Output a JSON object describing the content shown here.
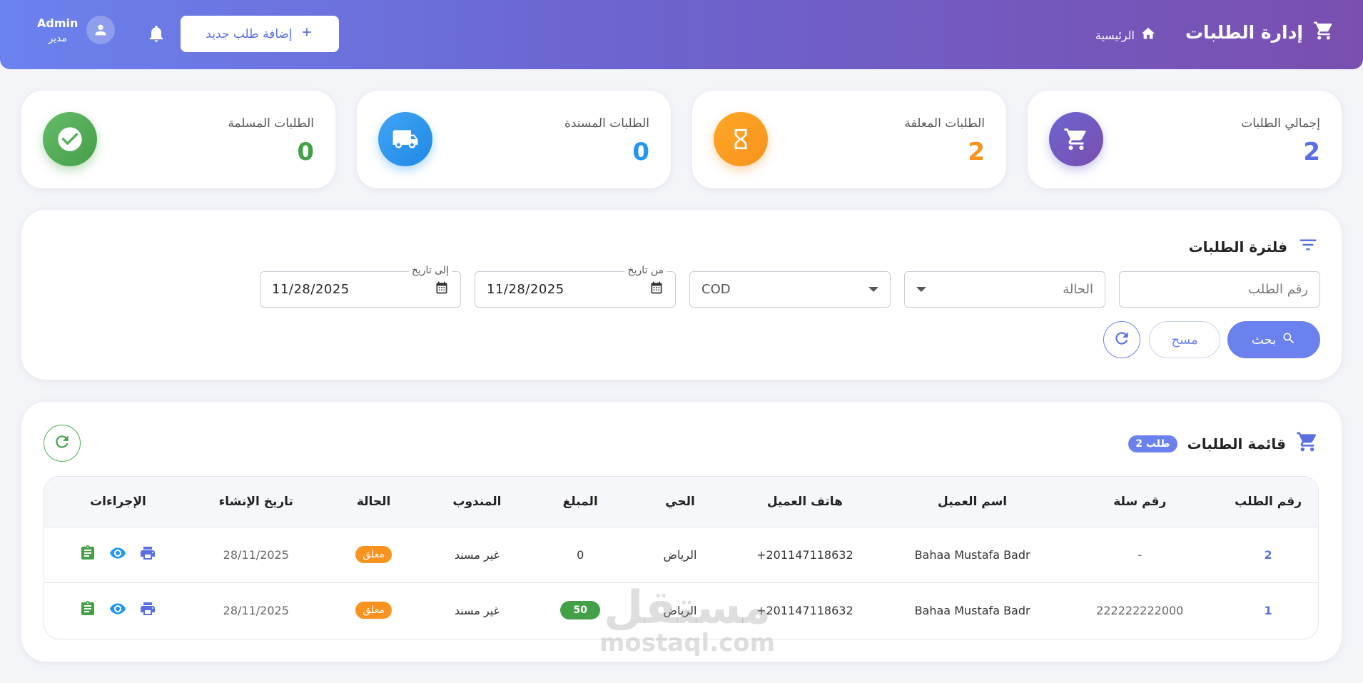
{
  "header": {
    "title": "إدارة الطلبات",
    "home_label": "الرئيسية",
    "add_button": "إضافة طلب جديد",
    "user_name": "Admin",
    "user_role": "مدير"
  },
  "stats": [
    {
      "label": "إجمالي الطلبات",
      "value": "2",
      "color": "#5a6fe0",
      "icon": "cart-icon"
    },
    {
      "label": "الطلبات المعلقة",
      "value": "2",
      "color": "#f7931e",
      "icon": "hourglass-icon"
    },
    {
      "label": "الطلبات المسندة",
      "value": "0",
      "color": "#2196f3",
      "icon": "truck-icon"
    },
    {
      "label": "الطلبات المسلمة",
      "value": "0",
      "color": "#43a047",
      "icon": "check-circle-icon"
    }
  ],
  "filter": {
    "title": "فلترة الطلبات",
    "order_number_placeholder": "رقم الطلب",
    "status_placeholder": "الحالة",
    "payment_value": "COD",
    "from_date_label": "من تاريخ",
    "from_date_value": "11/28/2025",
    "to_date_label": "إلى تاريخ",
    "to_date_value": "11/28/2025",
    "search_button": "بحث",
    "clear_button": "مسح"
  },
  "orders": {
    "title": "قائمة الطلبات",
    "count_badge": "2 طلب",
    "columns": [
      "رقم الطلب",
      "رقم سلة",
      "اسم العميل",
      "هاتف العميل",
      "الحي",
      "المبلغ",
      "المندوب",
      "الحالة",
      "تاريخ الإنشاء",
      "الإجراءات"
    ],
    "rows": [
      {
        "id": "2",
        "salla": "-",
        "customer": "Bahaa Mustafa Badr",
        "phone": "+201147118632",
        "district": "الرياض",
        "amount": "0",
        "agent": "غير مسند",
        "status": "معلق",
        "created": "28/11/2025"
      },
      {
        "id": "1",
        "salla": "222222222000",
        "customer": "Bahaa Mustafa Badr",
        "phone": "+201147118632",
        "district": "الرياض",
        "amount": "50",
        "agent": "غير مسند",
        "status": "معلق",
        "created": "28/11/2025"
      }
    ]
  },
  "watermark": {
    "arabic": "مستقل",
    "latin": "mostaql.com"
  }
}
